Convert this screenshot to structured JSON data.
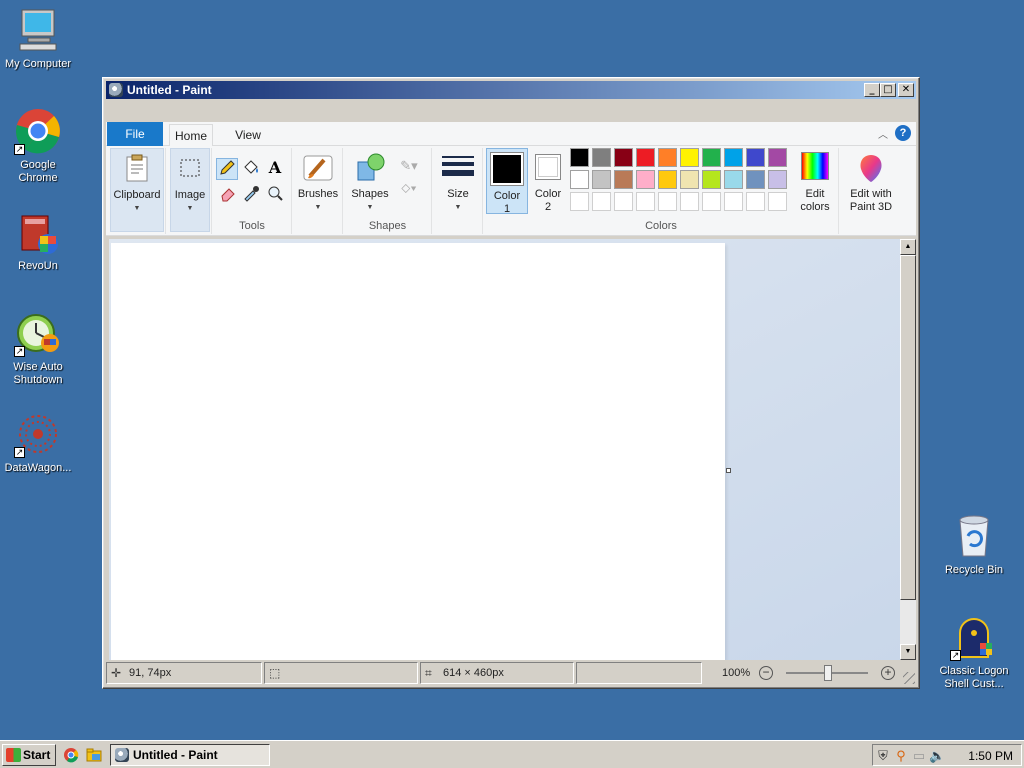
{
  "desktop": {
    "icons": [
      {
        "label": "My Computer"
      },
      {
        "label": "Google Chrome"
      },
      {
        "label": "RevoUn"
      },
      {
        "label": "Wise Auto Shutdown"
      },
      {
        "label": "DataWagon..."
      },
      {
        "label": "Recycle Bin"
      },
      {
        "label": "Classic Logon Shell Cust..."
      }
    ]
  },
  "window": {
    "title": "Untitled - Paint",
    "controls": {
      "minimize": "_",
      "maximize": "□",
      "close": "✕"
    }
  },
  "ribbon": {
    "tabs": {
      "file": "File",
      "home": "Home",
      "view": "View"
    },
    "help": "?",
    "clipboard_label": "Clipboard",
    "image_label": "Image",
    "tools_group": "Tools",
    "brushes_label": "Brushes",
    "shapes_label": "Shapes",
    "shapes_group": "Shapes",
    "size_label": "Size",
    "color1_label": "Color 1",
    "color2_label": "Color 2",
    "colors_group": "Colors",
    "edit_colors_label": "Edit colors",
    "paint3d_label": "Edit with Paint 3D",
    "palette_row1": [
      "#000000",
      "#7f7f7f",
      "#880015",
      "#ed1c24",
      "#ff7f27",
      "#fff200",
      "#22b14c",
      "#00a2e8",
      "#3f48cc",
      "#a349a4"
    ],
    "palette_row2": [
      "#ffffff",
      "#c3c3c3",
      "#b97a57",
      "#ffaec9",
      "#ffc90e",
      "#efe4b0",
      "#b5e61d",
      "#99d9ea",
      "#7092be",
      "#c8bfe7"
    ],
    "color1": "#000000",
    "color2": "#ffffff"
  },
  "statusbar": {
    "cursor_pos": "91, 74px",
    "selection_size": "",
    "canvas_size": "614 × 460px",
    "zoom": "100%"
  },
  "taskbar": {
    "start": "Start",
    "task": "Untitled - Paint",
    "clock": "1:50 PM"
  }
}
